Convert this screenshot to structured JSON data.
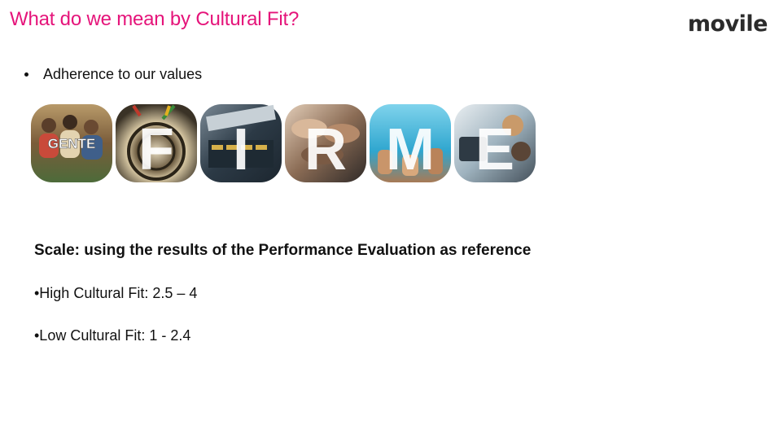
{
  "slide": {
    "title": "What do we mean by Cultural Fit?",
    "brand": "movile"
  },
  "bullets": [
    {
      "text": "Adherence to our values"
    }
  ],
  "values": {
    "tiles": [
      {
        "letter": "GENTE",
        "theme": "people-group"
      },
      {
        "letter": "F",
        "theme": "darts-target"
      },
      {
        "letter": "I",
        "theme": "uploading-ideas"
      },
      {
        "letter": "R",
        "theme": "hands-together"
      },
      {
        "letter": "M",
        "theme": "thumbs-up-sky"
      },
      {
        "letter": "E",
        "theme": "office-team"
      }
    ],
    "colors": {
      "people": "#8a6d3b",
      "darts": "#c9b27a",
      "ideas": "#3a4a58",
      "hands": "#6b5a4e",
      "sky": "#3fb4d6",
      "office": "#b9c9d2"
    }
  },
  "scale": {
    "heading": "Scale: using the results of the Performance Evaluation as reference",
    "high": "•High Cultural Fit: 2.5 – 4",
    "low": "•Low Cultural Fit: 1 - 2.4"
  },
  "theme": {
    "title_color": "#e5147a",
    "text_color": "#111111"
  }
}
